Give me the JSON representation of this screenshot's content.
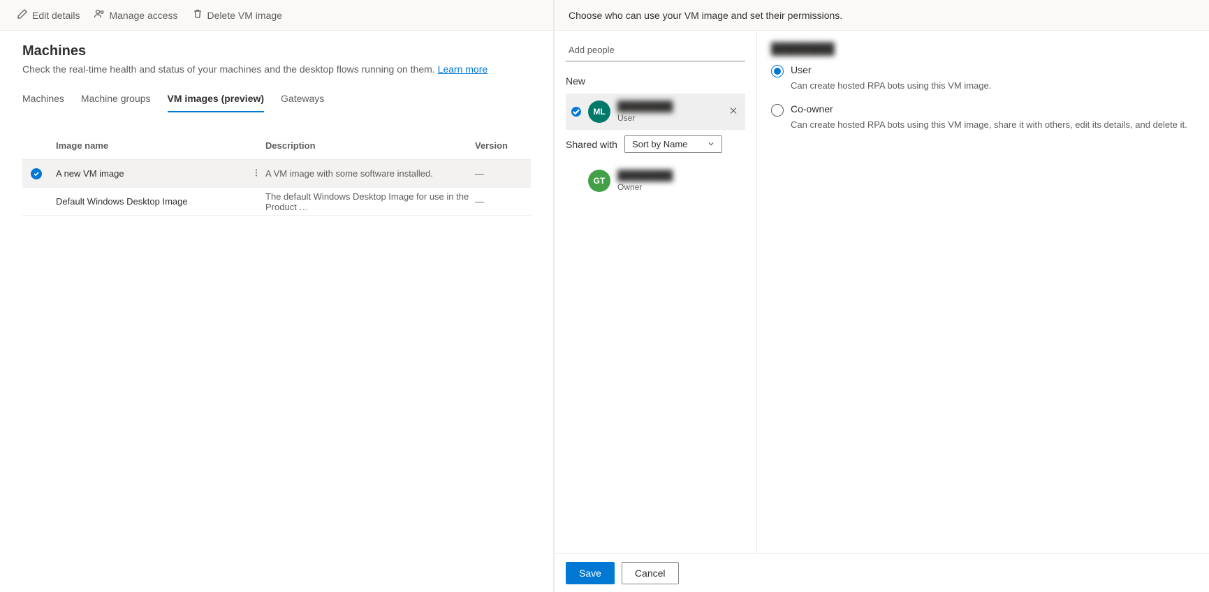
{
  "cmdbar": {
    "edit": "Edit details",
    "manage": "Manage access",
    "delete": "Delete VM image"
  },
  "page": {
    "title": "Machines",
    "subtitle_pre": "Check the real-time health and status of your machines and the desktop flows running on them. ",
    "learn_more": "Learn more"
  },
  "tabs": [
    "Machines",
    "Machine groups",
    "VM images (preview)",
    "Gateways"
  ],
  "active_tab": 2,
  "table": {
    "cols": [
      "Image name",
      "Description",
      "Version"
    ],
    "rows": [
      {
        "selected": true,
        "name": "A new VM image",
        "desc": "A VM image with some software installed.",
        "version": "—"
      },
      {
        "selected": false,
        "name": "Default Windows Desktop Image",
        "desc": "The default Windows Desktop Image for use in the Product …",
        "version": "—"
      }
    ]
  },
  "panel": {
    "intro": "Choose who can use your VM image and set their permissions.",
    "add_placeholder": "Add people",
    "new_label": "New",
    "new_item": {
      "initials": "ML",
      "name": "████████",
      "role": "User"
    },
    "shared_label": "Shared with",
    "sort_label": "Sort by Name",
    "shared_item": {
      "initials": "GT",
      "name": "████████",
      "role": "Owner"
    },
    "perm_title": "████████",
    "perms": [
      {
        "label": "User",
        "desc": "Can create hosted RPA bots using this VM image."
      },
      {
        "label": "Co-owner",
        "desc": "Can create hosted RPA bots using this VM image, share it with others, edit its details, and delete it."
      }
    ],
    "selected_perm": 0,
    "save": "Save",
    "cancel": "Cancel"
  }
}
